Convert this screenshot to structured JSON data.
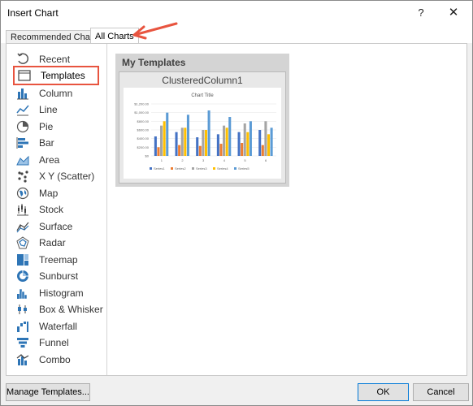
{
  "window": {
    "title": "Insert Chart",
    "help_label": "?",
    "close_label": "✕"
  },
  "tabs": [
    {
      "label": "Recommended Charts"
    },
    {
      "label": "All Charts"
    }
  ],
  "sidebar": {
    "items": [
      {
        "label": "Recent",
        "icon": "recent-icon"
      },
      {
        "label": "Templates",
        "icon": "templates-icon"
      },
      {
        "label": "Column",
        "icon": "column-chart-icon"
      },
      {
        "label": "Line",
        "icon": "line-chart-icon"
      },
      {
        "label": "Pie",
        "icon": "pie-chart-icon"
      },
      {
        "label": "Bar",
        "icon": "bar-chart-icon"
      },
      {
        "label": "Area",
        "icon": "area-chart-icon"
      },
      {
        "label": "X Y (Scatter)",
        "icon": "scatter-chart-icon"
      },
      {
        "label": "Map",
        "icon": "map-chart-icon"
      },
      {
        "label": "Stock",
        "icon": "stock-chart-icon"
      },
      {
        "label": "Surface",
        "icon": "surface-chart-icon"
      },
      {
        "label": "Radar",
        "icon": "radar-chart-icon"
      },
      {
        "label": "Treemap",
        "icon": "treemap-chart-icon"
      },
      {
        "label": "Sunburst",
        "icon": "sunburst-chart-icon"
      },
      {
        "label": "Histogram",
        "icon": "histogram-chart-icon"
      },
      {
        "label": "Box & Whisker",
        "icon": "box-whisker-chart-icon"
      },
      {
        "label": "Waterfall",
        "icon": "waterfall-chart-icon"
      },
      {
        "label": "Funnel",
        "icon": "funnel-chart-icon"
      },
      {
        "label": "Combo",
        "icon": "combo-chart-icon"
      }
    ],
    "selected": "Templates"
  },
  "templates": {
    "heading": "My Templates",
    "items": [
      {
        "name": "ClusteredColumn1"
      }
    ]
  },
  "chart_data": {
    "type": "bar",
    "title": "Chart Title",
    "categories": [
      "1",
      "2",
      "3",
      "4",
      "5",
      "6"
    ],
    "ylim": [
      0,
      1200
    ],
    "yticks": [
      "$1,200.00",
      "$1,000.00",
      "$800.00",
      "$600.00",
      "$400.00",
      "$200.00",
      "$0"
    ],
    "legend": "bottom",
    "series": [
      {
        "name": "Series1",
        "color": "#4472c4",
        "values": [
          450,
          550,
          430,
          500,
          550,
          600
        ]
      },
      {
        "name": "Series2",
        "color": "#ed7d31",
        "values": [
          200,
          250,
          230,
          280,
          300,
          250
        ]
      },
      {
        "name": "Series3",
        "color": "#a5a5a5",
        "values": [
          700,
          650,
          600,
          700,
          750,
          800
        ]
      },
      {
        "name": "Series4",
        "color": "#ffc000",
        "values": [
          800,
          650,
          600,
          650,
          550,
          500
        ]
      },
      {
        "name": "Series5",
        "color": "#5b9bd5",
        "values": [
          1000,
          950,
          1050,
          900,
          800,
          650
        ]
      }
    ]
  },
  "footer": {
    "manage_label": "Manage Templates...",
    "ok_label": "OK",
    "cancel_label": "Cancel"
  },
  "colors": {
    "accent_highlight": "#e8543f",
    "chart_icon_blue": "#2e75b6"
  }
}
